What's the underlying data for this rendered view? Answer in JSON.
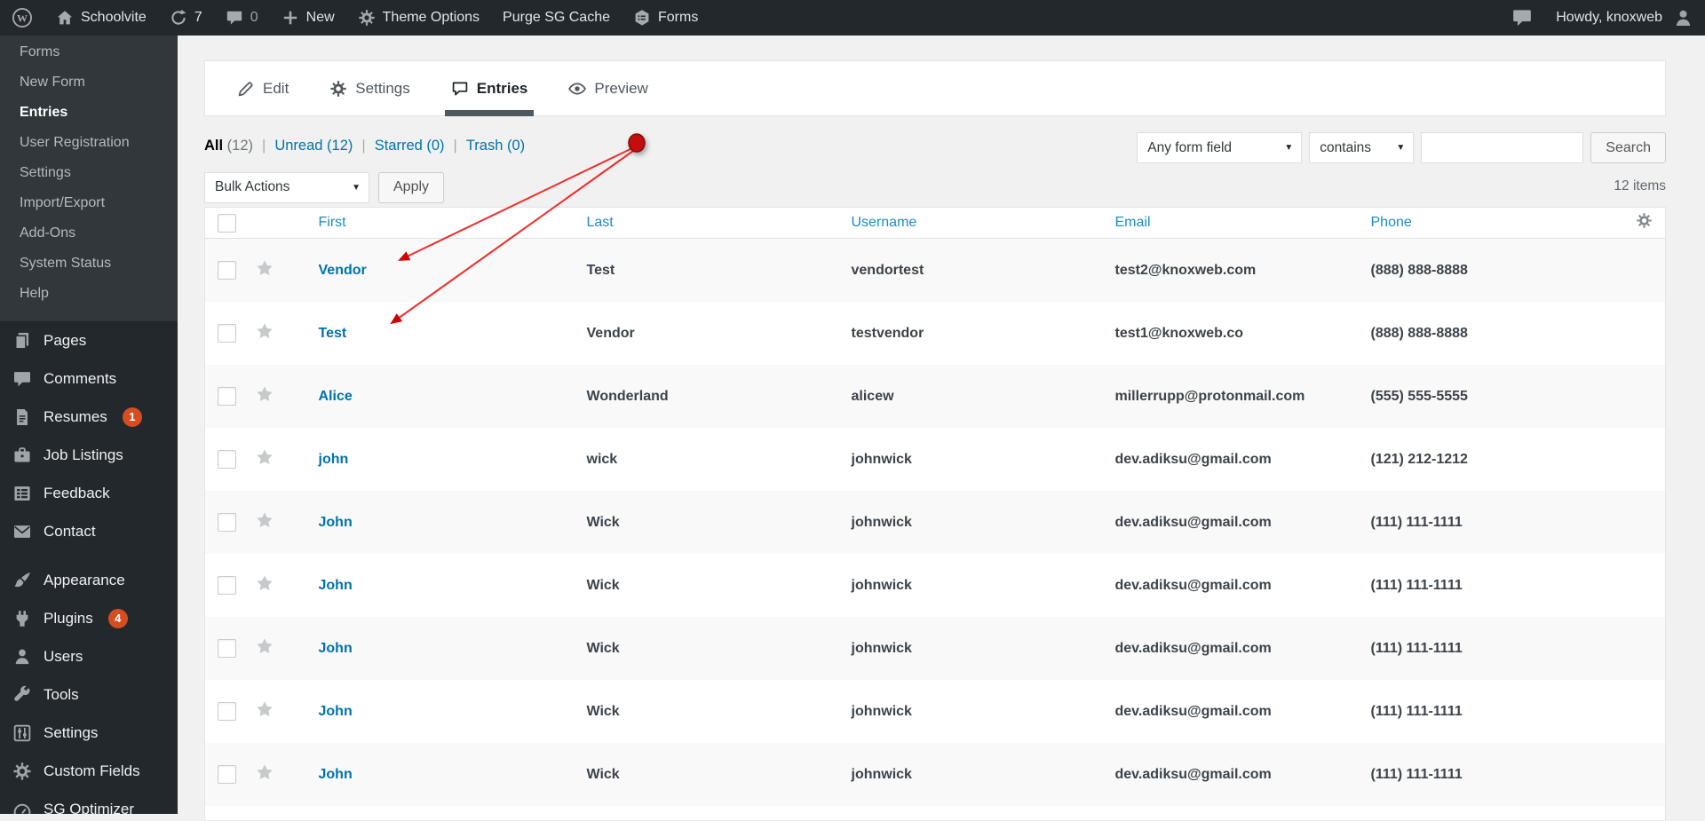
{
  "colors": {
    "accent_blue": "#0073aa",
    "header_blue": "#1e8cbe",
    "badge_red": "#d54e21",
    "annotation_red": "#ee2222",
    "admin_dark": "#23282d",
    "submenu_bg": "#32373c"
  },
  "admin_bar": {
    "site_name": "Schoolvite",
    "update_count": "7",
    "comment_count": "0",
    "new_label": "New",
    "theme_options_label": "Theme Options",
    "purge_cache_label": "Purge SG Cache",
    "forms_label": "Forms",
    "howdy": "Howdy, knoxweb"
  },
  "sidebar": {
    "submenu": [
      {
        "label": "Forms",
        "current": false
      },
      {
        "label": "New Form",
        "current": false
      },
      {
        "label": "Entries",
        "current": true
      },
      {
        "label": "User Registration",
        "current": false
      },
      {
        "label": "Settings",
        "current": false
      },
      {
        "label": "Import/Export",
        "current": false
      },
      {
        "label": "Add-Ons",
        "current": false
      },
      {
        "label": "System Status",
        "current": false
      },
      {
        "label": "Help",
        "current": false
      }
    ],
    "menu": [
      {
        "label": "Pages",
        "icon": "pages-icon"
      },
      {
        "label": "Comments",
        "icon": "comment-icon"
      },
      {
        "label": "Resumes",
        "icon": "document-icon",
        "badge": "1"
      },
      {
        "label": "Job Listings",
        "icon": "briefcase-icon"
      },
      {
        "label": "Feedback",
        "icon": "feedback-icon"
      },
      {
        "label": "Contact",
        "icon": "envelope-icon"
      },
      {
        "label": "Appearance",
        "icon": "brush-icon",
        "gap_before": true
      },
      {
        "label": "Plugins",
        "icon": "plug-icon",
        "badge": "4"
      },
      {
        "label": "Users",
        "icon": "user-icon"
      },
      {
        "label": "Tools",
        "icon": "wrench-icon"
      },
      {
        "label": "Settings",
        "icon": "sliders-icon"
      },
      {
        "label": "Custom Fields",
        "icon": "gear-icon"
      },
      {
        "label": "SG Optimizer",
        "icon": "speedometer-icon"
      }
    ]
  },
  "tabs": [
    {
      "label": "Edit",
      "icon": "pencil-icon",
      "active": false
    },
    {
      "label": "Settings",
      "icon": "gear-icon",
      "active": false
    },
    {
      "label": "Entries",
      "icon": "bubble-outline-icon",
      "active": true
    },
    {
      "label": "Preview",
      "icon": "eye-icon",
      "active": false
    }
  ],
  "filters": {
    "separator": "|",
    "items": [
      {
        "label": "All",
        "count": "(12)",
        "active": true
      },
      {
        "label": "Unread",
        "count": "(12)",
        "active": false
      },
      {
        "label": "Starred",
        "count": "(0)",
        "active": false
      },
      {
        "label": "Trash",
        "count": "(0)",
        "active": false
      }
    ]
  },
  "search": {
    "field_select": "Any form field",
    "operator_select": "contains",
    "input_value": "",
    "button_label": "Search"
  },
  "bulk": {
    "select_value": "Bulk Actions",
    "apply_label": "Apply"
  },
  "items_count": "12 items",
  "table": {
    "columns": [
      "First",
      "Last",
      "Username",
      "Email",
      "Phone"
    ],
    "rows": [
      {
        "first": "Vendor",
        "last": "Test",
        "username": "vendortest",
        "email": "test2@knoxweb.com",
        "phone": "(888) 888-8888"
      },
      {
        "first": "Test",
        "last": "Vendor",
        "username": "testvendor",
        "email": "test1@knoxweb.co",
        "phone": "(888) 888-8888"
      },
      {
        "first": "Alice",
        "last": "Wonderland",
        "username": "alicew",
        "email": "millerrupp@protonmail.com",
        "phone": "(555) 555-5555"
      },
      {
        "first": "john",
        "last": "wick",
        "username": "johnwick",
        "email": "dev.adiksu@gmail.com",
        "phone": "(121) 212-1212"
      },
      {
        "first": "John",
        "last": "Wick",
        "username": "johnwick",
        "email": "dev.adiksu@gmail.com",
        "phone": "(111) 111-1111"
      },
      {
        "first": "John",
        "last": "Wick",
        "username": "johnwick",
        "email": "dev.adiksu@gmail.com",
        "phone": "(111) 111-1111"
      },
      {
        "first": "John",
        "last": "Wick",
        "username": "johnwick",
        "email": "dev.adiksu@gmail.com",
        "phone": "(111) 111-1111"
      },
      {
        "first": "John",
        "last": "Wick",
        "username": "johnwick",
        "email": "dev.adiksu@gmail.com",
        "phone": "(111) 111-1111"
      },
      {
        "first": "John",
        "last": "Wick",
        "username": "johnwick",
        "email": "dev.adiksu@gmail.com",
        "phone": "(111) 111-1111"
      }
    ]
  }
}
